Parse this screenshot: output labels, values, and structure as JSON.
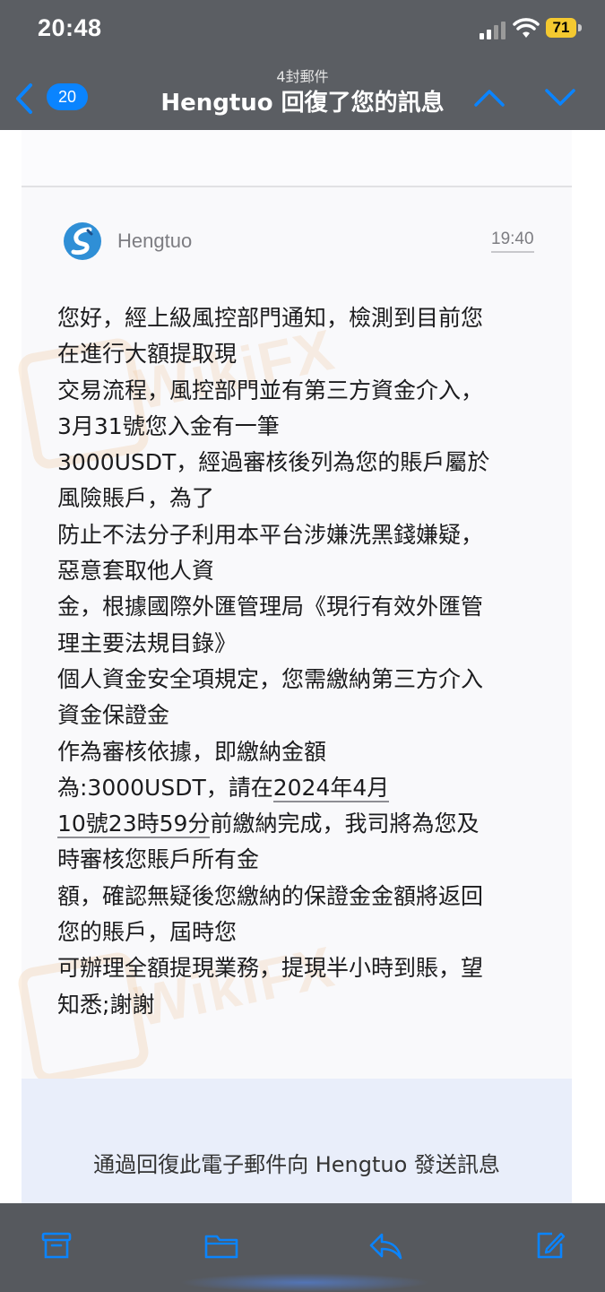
{
  "status_bar": {
    "time": "20:48",
    "battery": "71"
  },
  "nav": {
    "unread_count": "20",
    "message_count": "4封郵件",
    "title": "Hengtuo 回復了您的訊息"
  },
  "message": {
    "sender": "Hengtuo",
    "time": "19:40",
    "lines": [
      "您好，經上級風控部門通知，檢測到目前您",
      "在進行大額提取現",
      "交易流程，風控部門並有第三方資金介入，",
      "3月31號您入金有一筆",
      "3000USDT，經過審核後列為您的賬戶屬於",
      "風險賬戶，為了",
      "防止不法分子利用本平台涉嫌洗黑錢嫌疑，",
      "惡意套取他人資",
      "金，根據國際外匯管理局《現行有效外匯管",
      "理主要法規目錄》",
      "個人資金安全項規定，您需繳納第三方介入",
      "資金保證金",
      "作為審核依據，即繳納金額",
      "為:3000USDT，請在",
      "2024年4月",
      "10號23時59分",
      "前繳納完成，我司將為您及",
      "時審核您賬戶所有金",
      "額，確認無疑後您繳納的保證金金額將返回",
      "您的賬戶，屆時您",
      "可辦理全額提現業務，提現半小時到賬，望",
      "知悉;謝謝"
    ]
  },
  "reply_prompt": "通過回復此電子郵件向 Hengtuo 發送訊息",
  "watermark": "WikiFX",
  "colors": {
    "accent": "#0a84ff",
    "battery": "#f4c930",
    "bar": "#5b5e63"
  }
}
